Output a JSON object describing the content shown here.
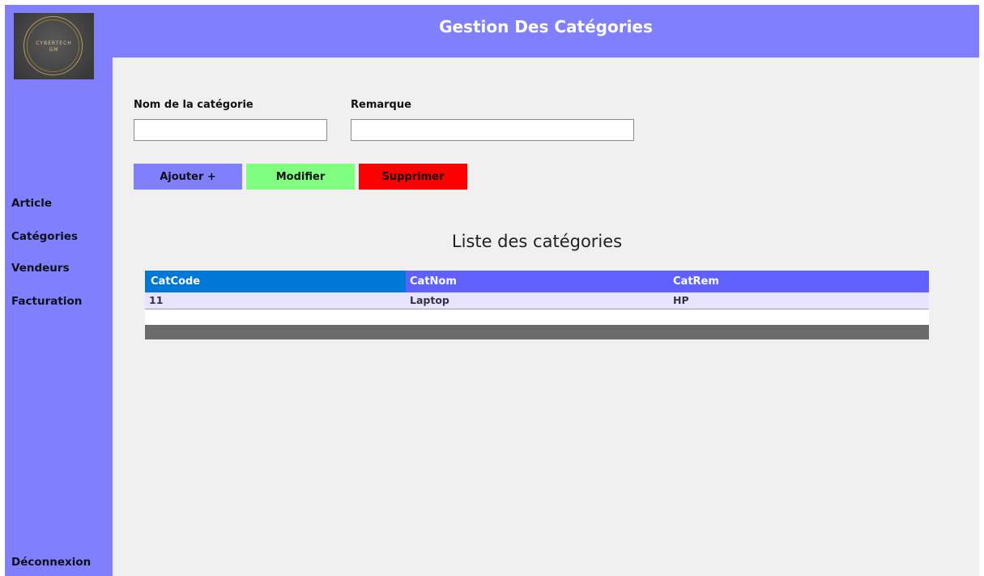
{
  "header": {
    "title": "Gestion Des Catégories"
  },
  "logo": {
    "text_line1": "CYBERTECH",
    "text_line2": "GM"
  },
  "sidebar": {
    "items": [
      {
        "label": "Article"
      },
      {
        "label": "Catégories"
      },
      {
        "label": "Vendeurs"
      },
      {
        "label": "Facturation"
      }
    ],
    "logout": "Déconnexion"
  },
  "form": {
    "name_label": "Nom de la catégorie",
    "name_value": "",
    "remark_label": "Remarque",
    "remark_value": ""
  },
  "buttons": {
    "add": "Ajouter +",
    "edit": "Modifier",
    "delete": "Supprimer"
  },
  "list": {
    "title": "Liste des catégories",
    "columns": [
      "CatCode",
      "CatNom",
      "CatRem"
    ],
    "rows": [
      [
        "11",
        "Laptop",
        "HP"
      ]
    ]
  },
  "colors": {
    "accent": "#8080ff",
    "add_button": "#8080ff",
    "edit_button": "#80ff80",
    "delete_button": "#ff0000",
    "grid_header": "#6060ff",
    "grid_first_header": "#0078d7"
  }
}
